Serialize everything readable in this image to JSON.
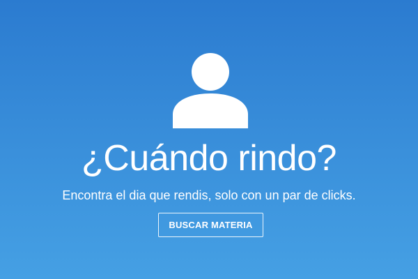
{
  "hero": {
    "icon": "user-icon",
    "title": "¿Cuándo rindo?",
    "subtitle": "Encontra el dia que rendis, solo con un par de clicks.",
    "button_label": "BUSCAR MATERIA"
  },
  "colors": {
    "gradient_top": "#2b7bd0",
    "gradient_bottom": "#45a0e4",
    "foreground": "#ffffff"
  }
}
